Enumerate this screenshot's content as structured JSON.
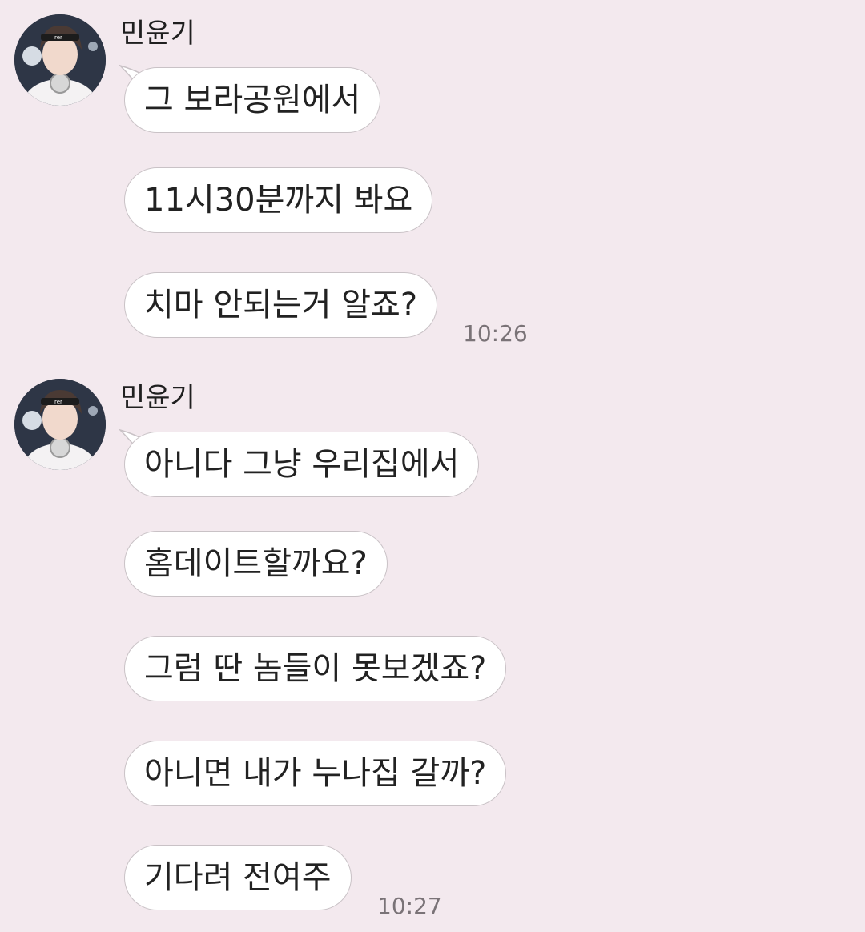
{
  "groups": [
    {
      "sender": "민윤기",
      "avatar_icon": "profile-photo",
      "messages": [
        "그 보라공원에서",
        "11시30분까지 봐요",
        "치마 안되는거 알죠?"
      ],
      "time": "10:26"
    },
    {
      "sender": "민윤기",
      "avatar_icon": "profile-photo",
      "messages": [
        "아니다 그냥 우리집에서",
        "홈데이트할까요?",
        "그럼 딴 놈들이 못보겠죠?",
        "아니면 내가 누나집 갈까?",
        "기다려 전여주"
      ],
      "time": "10:27"
    }
  ],
  "colors": {
    "background": "#f3e9ee",
    "bubble": "#ffffff",
    "bubble_border": "#c9c2c6",
    "time_text": "#7a7377"
  }
}
